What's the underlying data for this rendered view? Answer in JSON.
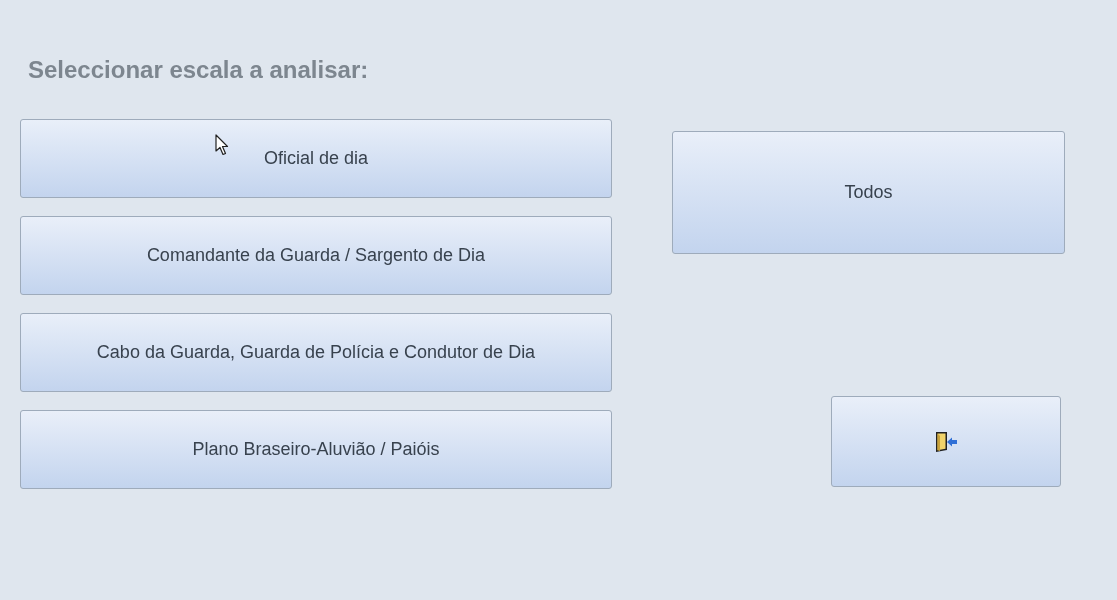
{
  "heading": "Seleccionar escala a analisar:",
  "scale_buttons": [
    {
      "label": "Oficial de dia"
    },
    {
      "label": "Comandante da Guarda / Sargento de Dia"
    },
    {
      "label": "Cabo da Guarda, Guarda de Polícia e Condutor de Dia"
    },
    {
      "label": "Plano Braseiro-Aluvião / Paióis"
    }
  ],
  "all_button": {
    "label": "Todos"
  }
}
